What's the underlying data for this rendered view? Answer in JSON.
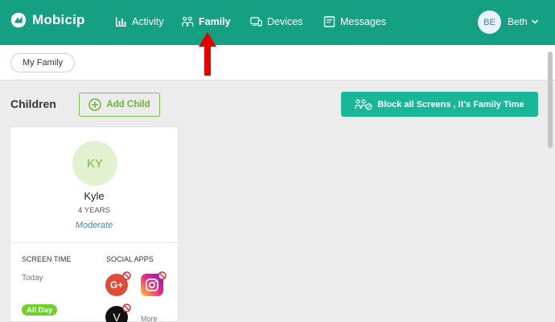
{
  "brand": {
    "name": "Mobicip"
  },
  "nav": {
    "items": [
      {
        "label": "Activity",
        "icon": "bar-chart-icon"
      },
      {
        "label": "Family",
        "icon": "family-icon",
        "active": true
      },
      {
        "label": "Devices",
        "icon": "devices-icon"
      },
      {
        "label": "Messages",
        "icon": "message-icon"
      }
    ]
  },
  "user": {
    "initials": "BE",
    "name": "Beth"
  },
  "subnav": {
    "tab": "My Family"
  },
  "children_section": {
    "title": "Children",
    "add_child_label": "Add Child",
    "block_label": "Block all Screens , It's Family Time"
  },
  "child": {
    "initials": "KY",
    "name": "Kyle",
    "age": "4 YEARS",
    "level": "Moderate",
    "screen_time_label": "SCREEN TIME",
    "screen_time_day": "Today",
    "screen_time_value": "All Day",
    "social_apps_label": "SOCIAL APPS",
    "apps": [
      {
        "name": "google-plus",
        "glyph": "G+"
      },
      {
        "name": "instagram"
      },
      {
        "name": "vine",
        "glyph": "V"
      }
    ],
    "more_label": "More"
  },
  "colors": {
    "nav_bg": "#15a084",
    "accent_green": "#7bbf44",
    "block_btn": "#1ab699",
    "annotation_arrow": "#e50000"
  }
}
